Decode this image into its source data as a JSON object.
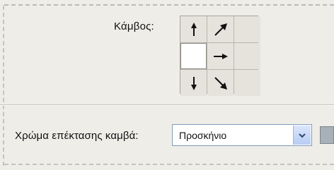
{
  "anchor": {
    "label": "Κάμβος:",
    "selected_cell": "middle-left",
    "cells": [
      {
        "id": "top-left",
        "icon": "arrow-up-icon"
      },
      {
        "id": "top-center",
        "icon": "arrow-up-right-icon"
      },
      {
        "id": "top-right",
        "icon": "none"
      },
      {
        "id": "middle-left",
        "icon": "none"
      },
      {
        "id": "middle-center",
        "icon": "arrow-right-icon"
      },
      {
        "id": "middle-right",
        "icon": "none"
      },
      {
        "id": "bottom-left",
        "icon": "arrow-down-icon"
      },
      {
        "id": "bottom-center",
        "icon": "arrow-down-right-icon"
      },
      {
        "id": "bottom-right",
        "icon": "none"
      }
    ]
  },
  "extension_color": {
    "label": "Χρώμα επέκτασης καμβά:",
    "value": "Προσκήνιο",
    "swatch_color": "#a8b0b8"
  }
}
